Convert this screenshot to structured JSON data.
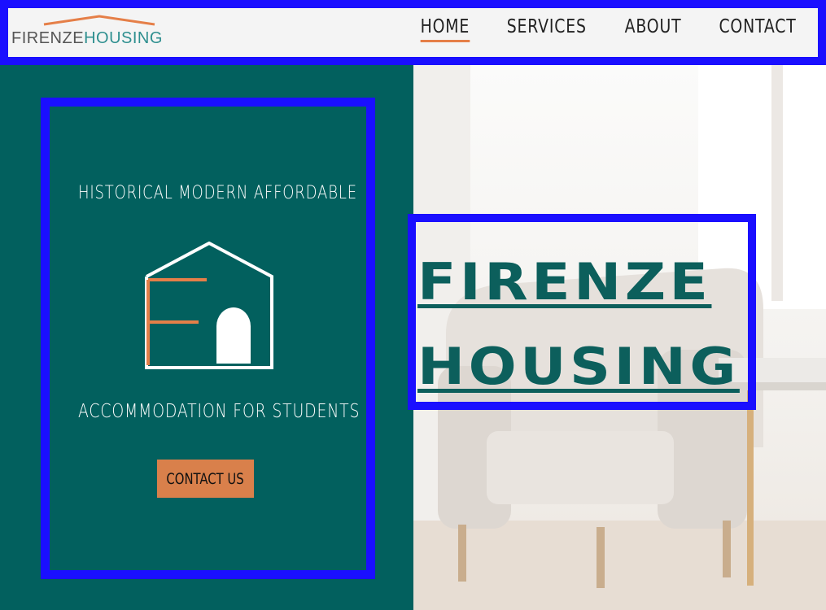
{
  "header": {
    "logo": {
      "part1": "FIRENZE",
      "part2": "HOUSING"
    },
    "nav": [
      {
        "label": "HOME",
        "active": true
      },
      {
        "label": "SERVICES",
        "active": false
      },
      {
        "label": "ABOUT",
        "active": false
      },
      {
        "label": "CONTACT",
        "active": false
      }
    ]
  },
  "hero": {
    "tagline_top": "HISTORICAL MODERN AFFORDABLE",
    "tagline_bottom": "ACCOMMODATION FOR STUDENTS",
    "cta_label": "CONTACT US",
    "title_line1": "FIRENZE",
    "title_line2": "HOUSING"
  },
  "colors": {
    "teal": "#02605e",
    "accent": "#d9804b",
    "highlight_border": "#1a0fff",
    "title_color": "#0c5f5c"
  }
}
